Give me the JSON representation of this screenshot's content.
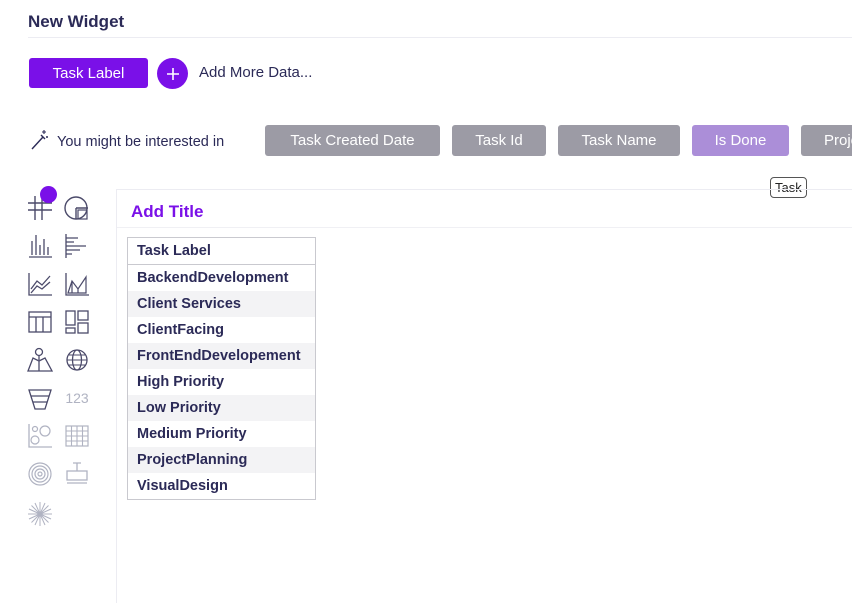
{
  "header": {
    "title": "New Widget"
  },
  "builder": {
    "selected_field": "Task Label",
    "add_more_label": "Add More Data..."
  },
  "suggestions": {
    "label": "You might be interested in",
    "chips": [
      "Task Created Date",
      "Task Id",
      "Task Name",
      "Is Done",
      "Project"
    ],
    "tooltip": "Task"
  },
  "viz_icons": [
    "grid-table",
    "pie-chart",
    "bar-chart",
    "horizontal-bar-chart",
    "line-chart",
    "area-chart",
    "table",
    "layout",
    "map",
    "globe",
    "funnel",
    "number",
    "bubble",
    "heatmap",
    "radial",
    "box-plot",
    "burst"
  ],
  "number_icon_text": "123",
  "canvas": {
    "title": "Add Title",
    "table": {
      "header": "Task Label",
      "rows": [
        "BackendDevelopment",
        "Client Services",
        "ClientFacing",
        "FrontEndDevelopement",
        "High Priority",
        "Low Priority",
        "Medium Priority",
        "ProjectPlanning",
        "VisualDesign"
      ]
    }
  },
  "colors": {
    "accent": "#7a10e8",
    "chip": "#9c9ba5",
    "chip_active": "#ab8ed8",
    "text": "#2b2a57"
  }
}
